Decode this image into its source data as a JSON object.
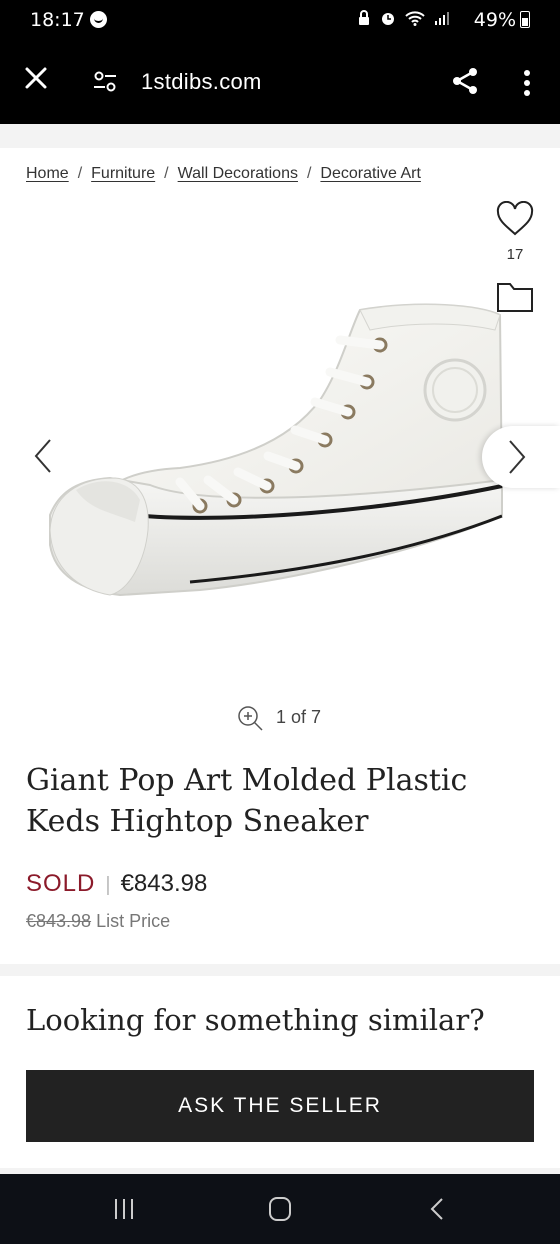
{
  "status_bar": {
    "time": "18:17",
    "battery_percent": "49%",
    "icons": [
      "whatsapp-icon",
      "lock-icon",
      "alarm-icon",
      "wifi-icon",
      "signal-icon",
      "battery-icon"
    ]
  },
  "browser": {
    "url": "1stdibs.com",
    "icons": [
      "close-icon",
      "tune-icon",
      "share-icon",
      "more-icon"
    ]
  },
  "breadcrumb": {
    "home": "Home",
    "furniture": "Furniture",
    "wall_decorations": "Wall Decorations",
    "decorative_art": "Decorative Art",
    "separator": "/"
  },
  "favorite": {
    "count": "17"
  },
  "gallery": {
    "counter": "1 of 7"
  },
  "product": {
    "title": "Giant Pop Art Molded Plastic Keds Hightop Sneaker",
    "status": "SOLD",
    "price": "€843.98",
    "list_price": "€843.98",
    "list_price_label": "List Price"
  },
  "similar": {
    "heading": "Looking for something similar?",
    "button_label": "ASK THE SELLER"
  },
  "colors": {
    "sold": "#8b1a2a",
    "button_bg": "#222222",
    "browser_bar": "#000000",
    "nav_bar": "#0d1016"
  }
}
